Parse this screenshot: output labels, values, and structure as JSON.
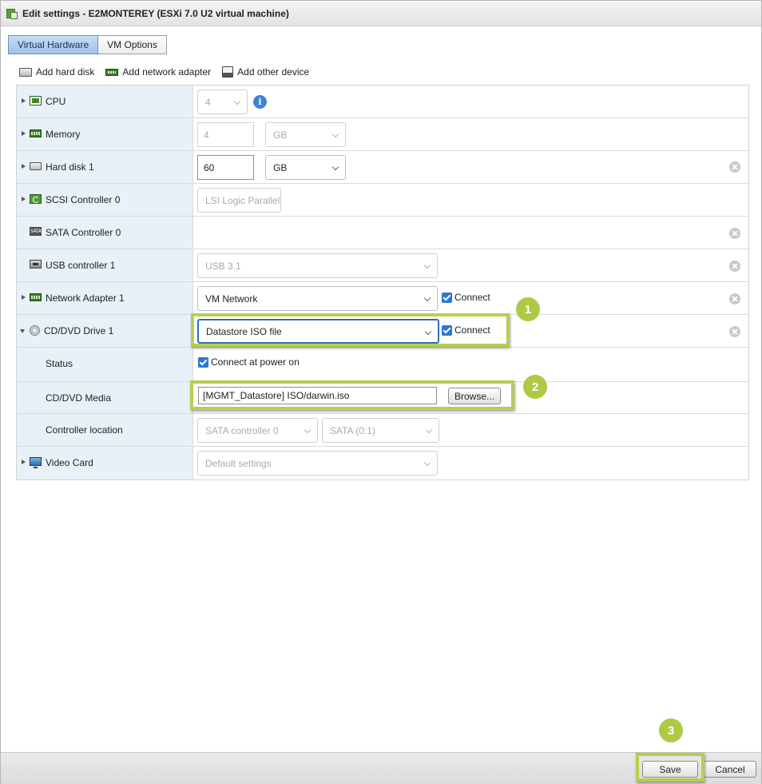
{
  "window": {
    "title": "Edit settings - E2MONTEREY (ESXi 7.0 U2 virtual machine)"
  },
  "tabs": [
    {
      "label": "Virtual Hardware",
      "active": true
    },
    {
      "label": "VM Options",
      "active": false
    }
  ],
  "toolbar": {
    "add_hard_disk": "Add hard disk",
    "add_network_adapter": "Add network adapter",
    "add_other_device": "Add other device"
  },
  "hardware": {
    "cpu": {
      "label": "CPU",
      "value": "4"
    },
    "memory": {
      "label": "Memory",
      "value": "4",
      "unit": "GB"
    },
    "hard_disk": {
      "label": "Hard disk 1",
      "value": "60",
      "unit": "GB"
    },
    "scsi": {
      "label": "SCSI Controller 0",
      "value": "LSI Logic Parallel"
    },
    "sata": {
      "label": "SATA Controller 0"
    },
    "usb": {
      "label": "USB controller 1",
      "value": "USB 3.1"
    },
    "network": {
      "label": "Network Adapter 1",
      "value": "VM Network",
      "connect_label": "Connect",
      "connected": true
    },
    "cdrom": {
      "label": "CD/DVD Drive 1",
      "value": "Datastore ISO file",
      "connect_label": "Connect",
      "connected": true,
      "status_label": "Status",
      "status_value": "Connect at power on",
      "media_label": "CD/DVD Media",
      "media_value": "[MGMT_Datastore] ISO/darwin.iso",
      "browse_label": "Browse...",
      "controller_label": "Controller location",
      "controller_value": "SATA controller 0",
      "controller_slot": "SATA (0:1)"
    },
    "video": {
      "label": "Video Card",
      "value": "Default settings"
    }
  },
  "annotations": {
    "badge1": "1",
    "badge2": "2",
    "badge3": "3",
    "highlight_color": "#b5cf50"
  },
  "footer": {
    "save_label": "Save",
    "cancel_label": "Cancel"
  }
}
